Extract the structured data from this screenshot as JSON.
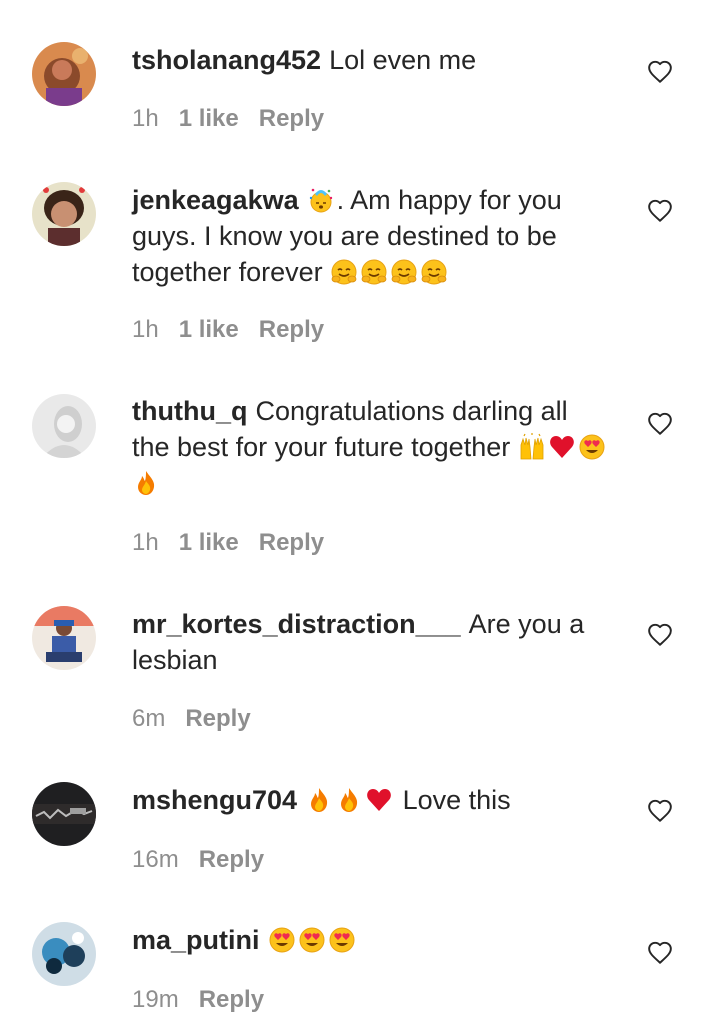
{
  "comments": [
    {
      "username": "tsholanang452",
      "segments": [
        {
          "t": "text",
          "v": "Lol even me"
        }
      ],
      "time": "1h",
      "likes": "1 like",
      "reply": "Reply",
      "avatar": "avatar-orange"
    },
    {
      "username": "jenkeagakwa",
      "segments": [
        {
          "t": "emoji",
          "v": "party-popper-face-emoji"
        },
        {
          "t": "text",
          "v": ". Am happy for you guys. I know you are destined to be together forever "
        },
        {
          "t": "emoji",
          "v": "hugging-face-emoji"
        },
        {
          "t": "emoji",
          "v": "hugging-face-emoji"
        },
        {
          "t": "emoji",
          "v": "hugging-face-emoji"
        },
        {
          "t": "emoji",
          "v": "hugging-face-emoji"
        }
      ],
      "time": "1h",
      "likes": "1 like",
      "reply": "Reply",
      "avatar": "avatar-woman"
    },
    {
      "username": "thuthu_q",
      "segments": [
        {
          "t": "text",
          "v": "Congratulations darling all the best for your future together "
        },
        {
          "t": "emoji",
          "v": "raising-hands-emoji"
        },
        {
          "t": "emoji",
          "v": "red-heart-emoji"
        },
        {
          "t": "emoji",
          "v": "heart-eyes-emoji"
        },
        {
          "t": "emoji",
          "v": "fire-emoji"
        }
      ],
      "time": "1h",
      "likes": "1 like",
      "reply": "Reply",
      "avatar": "avatar-grey"
    },
    {
      "username": "mr_kortes_distraction___",
      "segments": [
        {
          "t": "text",
          "v": "Are you a lesbian"
        }
      ],
      "time": "6m",
      "likes": "",
      "reply": "Reply",
      "avatar": "avatar-man"
    },
    {
      "username": "mshengu704",
      "segments": [
        {
          "t": "emoji",
          "v": "fire-emoji"
        },
        {
          "t": "emoji",
          "v": "fire-emoji"
        },
        {
          "t": "emoji",
          "v": "red-heart-emoji"
        },
        {
          "t": "text",
          "v": " Love this"
        }
      ],
      "time": "16m",
      "likes": "",
      "reply": "Reply",
      "avatar": "avatar-dark"
    },
    {
      "username": "ma_putini",
      "segments": [
        {
          "t": "emoji",
          "v": "heart-eyes-emoji"
        },
        {
          "t": "emoji",
          "v": "heart-eyes-emoji"
        },
        {
          "t": "emoji",
          "v": "heart-eyes-emoji"
        }
      ],
      "time": "19m",
      "likes": "",
      "reply": "Reply",
      "avatar": "avatar-blue"
    }
  ],
  "icons": {
    "like": "heart-outline-icon"
  },
  "colors": {
    "text": "#262626",
    "meta": "#8e8e8e"
  }
}
